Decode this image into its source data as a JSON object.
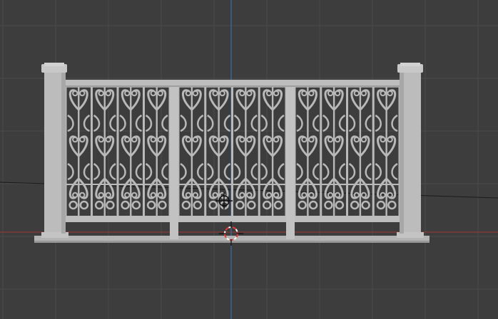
{
  "viewport": {
    "background": "#3d3d3d",
    "grid_minor_color": "#444444",
    "grid_major_color": "#4a4a4a",
    "axis_x_color": "#8b3a3a",
    "axis_y_color": "#3a6ea5",
    "horizon_line_color": "#1a1a1a"
  },
  "model": {
    "name": "wrought-iron-railing",
    "fill": "#b9b9b9",
    "shade": "#9a9a9a",
    "highlight": "#d0d0d0",
    "panel_count": 3,
    "pickets_per_panel": 4
  },
  "cursor_3d": {
    "ring_color": "#ffffff",
    "ring_accent": "#e03a3a"
  },
  "object_origin": {
    "color": "#111111"
  }
}
